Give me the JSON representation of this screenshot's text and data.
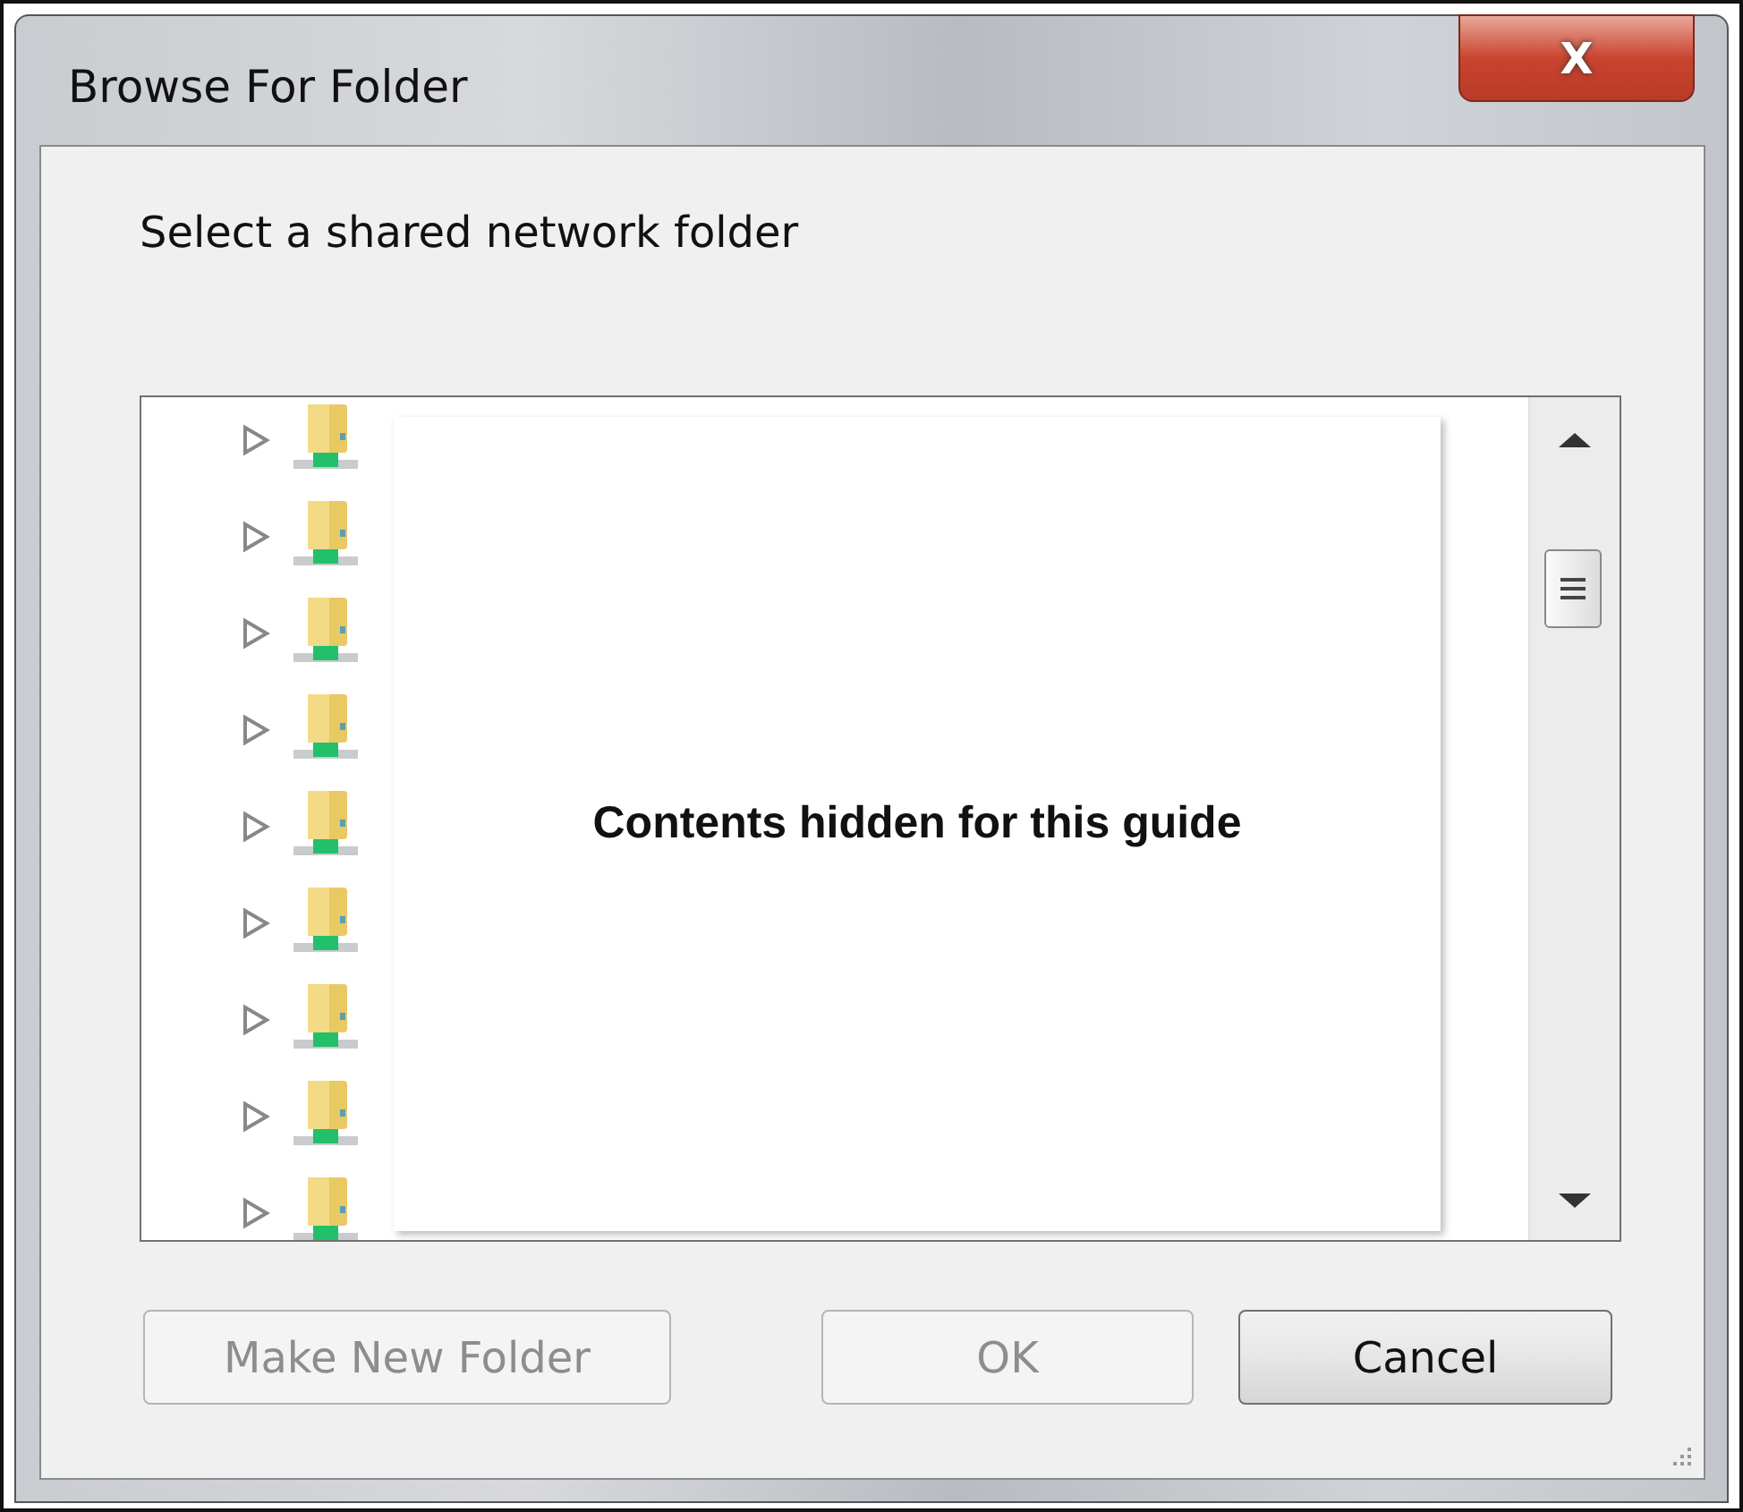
{
  "window": {
    "title": "Browse For Folder",
    "close_label": "X"
  },
  "prompt": "Select a shared network folder",
  "tree": {
    "items": [
      {
        "expanded": false
      },
      {
        "expanded": false
      },
      {
        "expanded": false
      },
      {
        "expanded": false
      },
      {
        "expanded": false
      },
      {
        "expanded": false
      },
      {
        "expanded": false
      },
      {
        "expanded": false
      },
      {
        "expanded": false
      }
    ],
    "overlay_text": "Contents hidden for this guide"
  },
  "buttons": [
    {
      "label": "Make New Folder",
      "disabled": true
    },
    {
      "label": "OK",
      "disabled": true
    },
    {
      "label": "Cancel",
      "disabled": false
    }
  ]
}
